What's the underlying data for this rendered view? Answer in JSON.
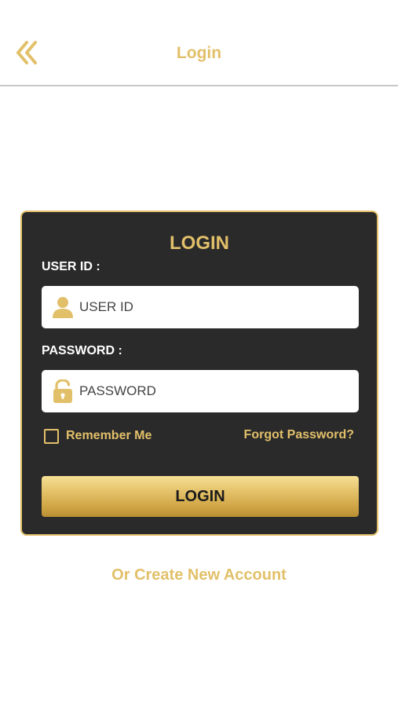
{
  "header": {
    "title": "Login",
    "back_icon": "double-chevron-left-icon"
  },
  "form": {
    "title": "LOGIN",
    "user_id_label": "USER ID :",
    "user_id_placeholder": "USER ID",
    "user_id_icon": "user-icon",
    "password_label": "PASSWORD :",
    "password_placeholder": "PASSWORD",
    "password_icon": "unlock-icon",
    "remember_label": "Remember Me",
    "remember_checked": false,
    "forgot_label": "Forgot Password?",
    "submit_label": "LOGIN"
  },
  "footer": {
    "create_account_label": "Or Create New Account"
  },
  "colors": {
    "accent": "#e2c06a",
    "card_background": "#2a2a2a",
    "page_background": "#ffffff"
  }
}
